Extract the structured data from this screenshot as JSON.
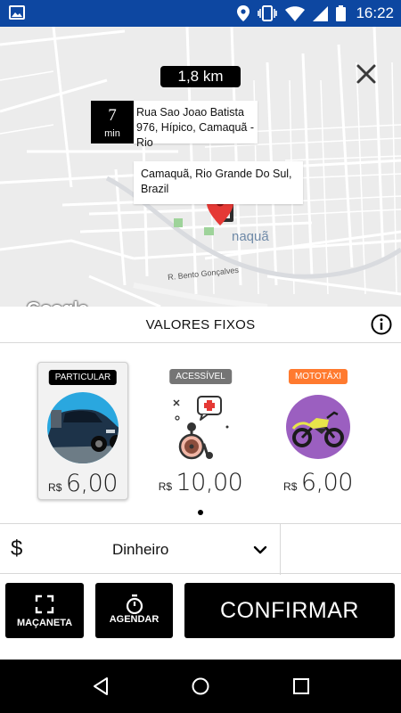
{
  "status_bar": {
    "time": "16:22",
    "icons": [
      "image-icon",
      "location-icon",
      "vibrate-icon",
      "wifi-icon",
      "signal-icon",
      "battery-icon"
    ]
  },
  "map": {
    "distance": "1,8 km",
    "eta_value": "7",
    "eta_unit": "min",
    "origin_address": "Rua Sao Joao Batista 976, Hípico, Camaquã - Rio",
    "destination_address": "Camaquã, Rio Grande Do Sul, Brazil",
    "street_label": "R. Bento Gonçalves",
    "city_label": "naquã",
    "logo": "Google",
    "marker_color": "#e53935"
  },
  "sheet": {
    "title": "VALORES FIXOS",
    "options": [
      {
        "badge": "PARTICULAR",
        "badge_color": "#000000",
        "currency": "R$",
        "price": "6,00",
        "icon": "car-icon",
        "selected": true
      },
      {
        "badge": "ACESSÍVEL",
        "badge_color": "#757575",
        "currency": "R$",
        "price": "10,00",
        "icon": "wheelchair-icon",
        "selected": false
      },
      {
        "badge": "MOTOTÁXI",
        "badge_color": "#ff7a2f",
        "currency": "R$",
        "price": "6,00",
        "icon": "motorcycle-icon",
        "selected": false
      }
    ],
    "payment": {
      "symbol": "$",
      "method": "Dinheiro"
    },
    "buttons": {
      "macaneta": "MAÇANETA",
      "agendar": "AGENDAR",
      "confirm": "CONFIRMAR"
    }
  }
}
